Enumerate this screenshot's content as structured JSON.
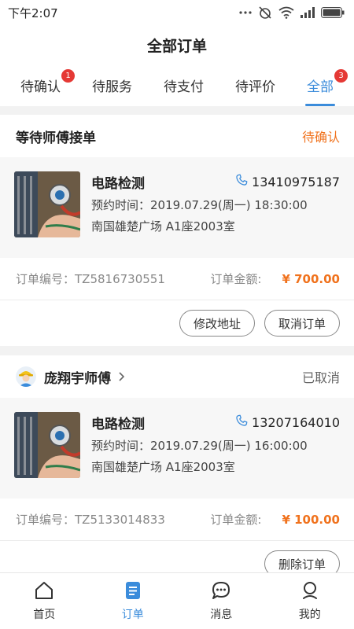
{
  "status_bar": {
    "time": "下午2:07"
  },
  "header": {
    "title": "全部订单"
  },
  "tabs": [
    {
      "label": "待确认",
      "badge": "1"
    },
    {
      "label": "待服务"
    },
    {
      "label": "待支付"
    },
    {
      "label": "待评价"
    },
    {
      "label": "全部",
      "badge": "3"
    }
  ],
  "orders": [
    {
      "head_title": "等待师傅接单",
      "status": "待确认",
      "service": "电路检测",
      "phone": "13410975187",
      "appointment": "预约时间：2019.07.29(周一) 18:30:00",
      "address": "南国雄楚广场 A1座2003室",
      "order_no_label": "订单编号：",
      "order_no": "TZ5816730551",
      "amount_label": "订单金额:",
      "amount": "¥ 700.00",
      "buttons": [
        "修改地址",
        "取消订单"
      ]
    },
    {
      "head_title": "庞翔宇师傅",
      "status": "已取消",
      "service": "电路检测",
      "phone": "13207164010",
      "appointment": "预约时间：2019.07.29(周一) 16:00:00",
      "address": "南国雄楚广场 A1座2003室",
      "order_no_label": "订单编号：",
      "order_no": "TZ5133014833",
      "amount_label": "订单金额:",
      "amount": "¥ 100.00",
      "buttons": [
        "删除订单"
      ]
    }
  ],
  "tabbar": [
    {
      "label": "首页",
      "icon": "home-icon"
    },
    {
      "label": "订单",
      "icon": "orders-icon"
    },
    {
      "label": "消息",
      "icon": "message-icon"
    },
    {
      "label": "我的",
      "icon": "profile-icon"
    }
  ],
  "colors": {
    "accent": "#3b8cdb",
    "price": "#f0721d",
    "badge": "#e53935"
  }
}
